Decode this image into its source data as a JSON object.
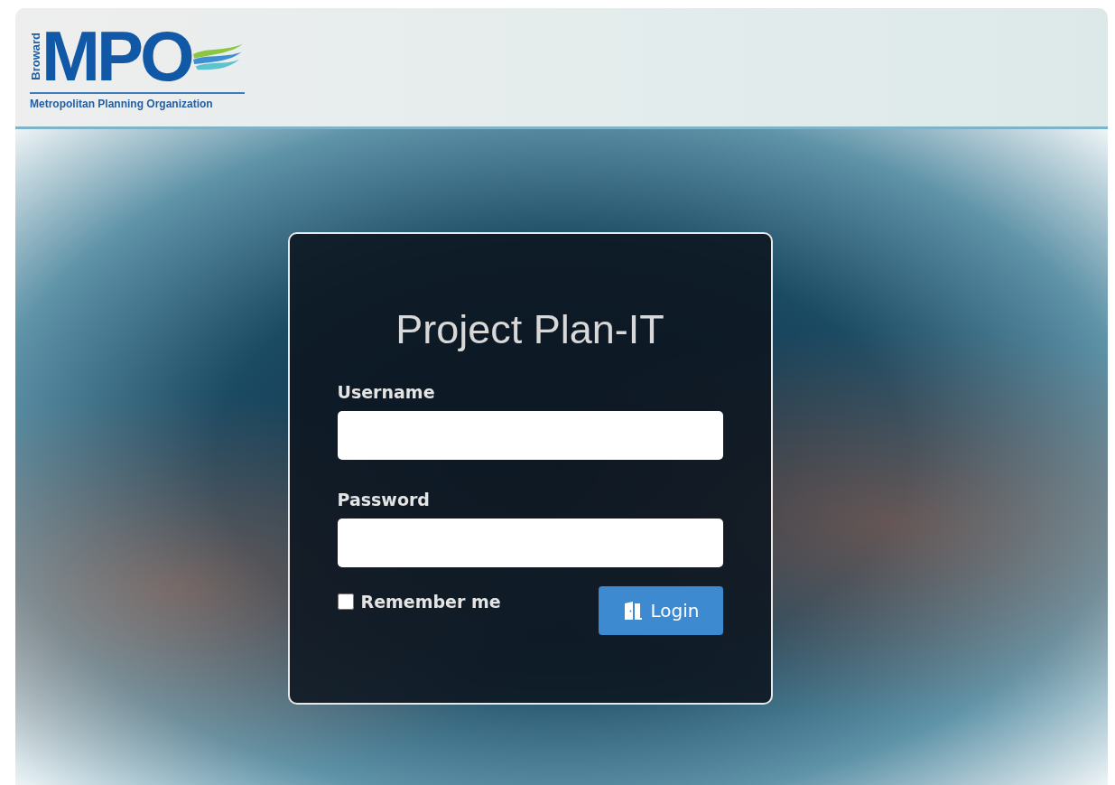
{
  "logo": {
    "side_text": "Broward",
    "mark": "MPO",
    "tagline": "Metropolitan Planning Organization"
  },
  "login": {
    "title": "Project Plan-IT",
    "fields": [
      {
        "label": "Username"
      },
      {
        "label": "Password"
      }
    ],
    "remember": {
      "label": "Remember me",
      "checked": false
    },
    "button": {
      "label": "Login"
    }
  }
}
